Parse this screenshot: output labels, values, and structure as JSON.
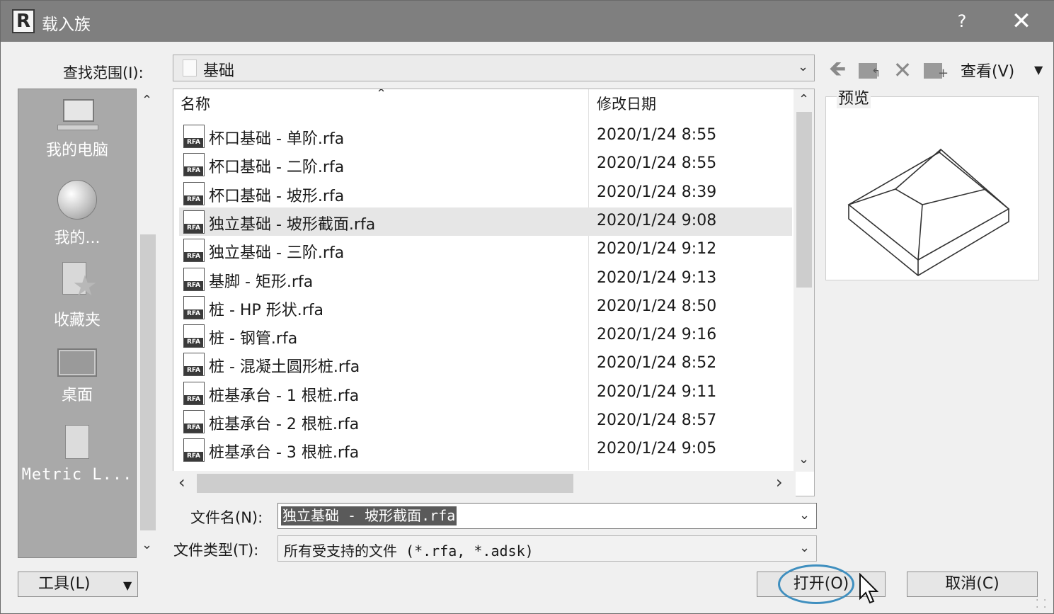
{
  "window": {
    "title": "载入族",
    "help": "?",
    "close": "✕"
  },
  "app_icon": "R",
  "lookin": {
    "label": "查找范围(I):",
    "value": "基础"
  },
  "toolbar": {
    "back": "🡸",
    "delete": "✕",
    "plus": "+",
    "up_arrow": "↰",
    "views_label": "查看(V)",
    "views_arrow": "▼"
  },
  "places": [
    {
      "label": "我的电脑",
      "icon": "computer-icon"
    },
    {
      "label": "我的...",
      "icon": "globe-network-icon"
    },
    {
      "label": "收藏夹",
      "icon": "favorites-star-icon"
    },
    {
      "label": "桌面",
      "icon": "desktop-icon"
    },
    {
      "label": "Metric L...",
      "icon": "folder-icon"
    }
  ],
  "scroll_glyphs": {
    "up": "⌃",
    "down": "⌄",
    "left": "‹",
    "right": "›",
    "sort": "⌃",
    "combo": "⌄"
  },
  "file_list": {
    "columns": {
      "name": "名称",
      "date": "修改日期"
    },
    "icon_text": "RFA",
    "rows": [
      {
        "name": "杯口基础 - 单阶.rfa",
        "date": "2020/1/24 8:55",
        "selected": false
      },
      {
        "name": "杯口基础 - 二阶.rfa",
        "date": "2020/1/24 8:55",
        "selected": false
      },
      {
        "name": "杯口基础 - 坡形.rfa",
        "date": "2020/1/24 8:39",
        "selected": false
      },
      {
        "name": "独立基础 - 坡形截面.rfa",
        "date": "2020/1/24 9:08",
        "selected": true
      },
      {
        "name": "独立基础 - 三阶.rfa",
        "date": "2020/1/24 9:12",
        "selected": false
      },
      {
        "name": "基脚 - 矩形.rfa",
        "date": "2020/1/24 9:13",
        "selected": false
      },
      {
        "name": "桩 - HP 形状.rfa",
        "date": "2020/1/24 8:50",
        "selected": false
      },
      {
        "name": "桩 - 钢管.rfa",
        "date": "2020/1/24 9:16",
        "selected": false
      },
      {
        "name": "桩 - 混凝土圆形桩.rfa",
        "date": "2020/1/24 8:52",
        "selected": false
      },
      {
        "name": "桩基承台 - 1 根桩.rfa",
        "date": "2020/1/24 9:11",
        "selected": false
      },
      {
        "name": "桩基承台 - 2 根桩.rfa",
        "date": "2020/1/24 8:57",
        "selected": false
      },
      {
        "name": "桩基承台 - 3 根桩.rfa",
        "date": "2020/1/24 9:05",
        "selected": false
      }
    ]
  },
  "preview": {
    "label": "预览"
  },
  "filename": {
    "label": "文件名(N):",
    "value": "独立基础 - 坡形截面.rfa"
  },
  "filetype": {
    "label": "文件类型(T):",
    "value": "所有受支持的文件 (*.rfa, *.adsk)"
  },
  "buttons": {
    "tools": "工具(L)",
    "open": "打开(O)",
    "cancel": "取消(C)"
  },
  "colors": {
    "titlebar": "#7f7f7f",
    "places_bg": "#a9a9a9",
    "highlight_ring": "#3f8fbf",
    "selected_row": "#e6e6e6"
  }
}
